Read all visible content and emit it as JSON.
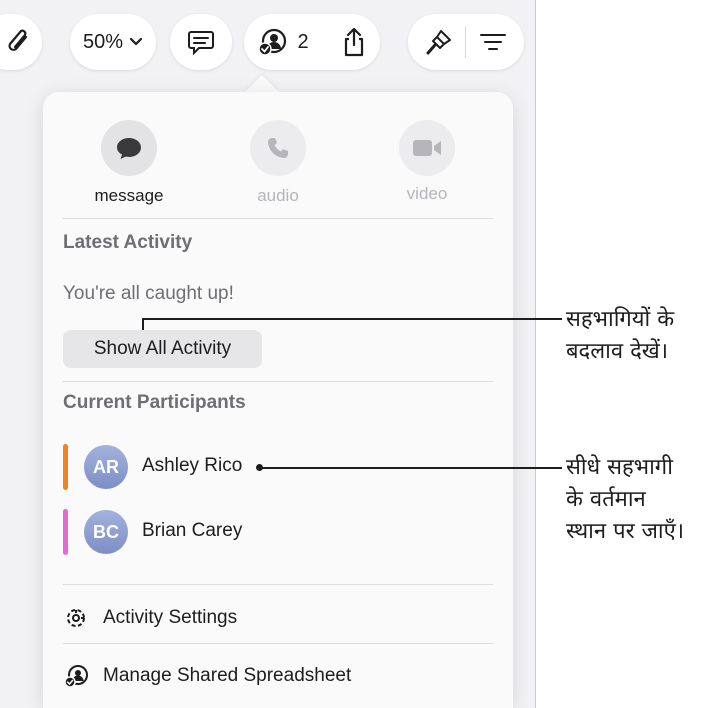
{
  "toolbar": {
    "zoom_label": "50%",
    "collaborator_count": "2",
    "icons": [
      "paperclip-icon",
      "chevron-down-icon",
      "comment-icon",
      "collaboration-icon",
      "share-icon",
      "format-brush-icon",
      "organize-icon"
    ]
  },
  "popover": {
    "communication": [
      {
        "label": "message",
        "icon": "message-bubble-icon",
        "enabled": true
      },
      {
        "label": "audio",
        "icon": "phone-icon",
        "enabled": false
      },
      {
        "label": "video",
        "icon": "video-camera-icon",
        "enabled": false
      }
    ],
    "latest_activity": {
      "title": "Latest Activity",
      "status": "You're all caught up!",
      "show_all_label": "Show All Activity"
    },
    "participants": {
      "title": "Current Participants",
      "items": [
        {
          "initials": "AR",
          "name": "Ashley Rico",
          "color": "#f0841e"
        },
        {
          "initials": "BC",
          "name": "Brian Carey",
          "color": "#e46bd6"
        }
      ]
    },
    "menu": [
      {
        "label": "Activity Settings",
        "icon": "activity-settings-icon"
      },
      {
        "label": "Manage Shared Spreadsheet",
        "icon": "manage-collaboration-icon"
      }
    ]
  },
  "callouts": {
    "view_changes": "सहभागियों के\nबदलाव देखें।",
    "jump_to_participant": "सीधे सहभागी\nके वर्तमान\nस्थान पर जाएँ।"
  },
  "colors": {
    "accent_orange": "#f0841e",
    "accent_pink": "#e46bd6",
    "avatar": "#8f9fd2"
  }
}
